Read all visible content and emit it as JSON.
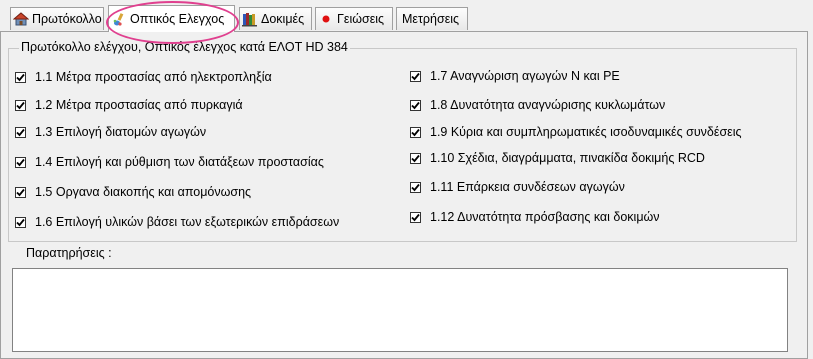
{
  "tabs": [
    {
      "label": "Πρωτόκολλο",
      "icon": "house-icon",
      "active": false
    },
    {
      "label": "Οπτικός Ελεγχος",
      "icon": "paint-brush-icon",
      "active": true
    },
    {
      "label": "Δοκιμές",
      "icon": "books-icon",
      "active": false
    },
    {
      "label": "Γειώσεις",
      "icon": "red-dot-icon",
      "active": false
    },
    {
      "label": "Μετρήσεις",
      "icon": "",
      "active": false
    }
  ],
  "group": {
    "title": "Πρωτόκολλο ελέγχου, Οπτικός έλεγχος κατά ΕΛΟΤ HD 384",
    "left_items": [
      {
        "label": "1.1 Μέτρα προστασίας από ηλεκτροπληξία",
        "checked": true
      },
      {
        "label": "1.2 Μέτρα προστασίας από πυρκαγιά",
        "checked": true
      },
      {
        "label": "1.3 Επιλογή διατομών αγωγών",
        "checked": true
      },
      {
        "label": "1.4 Επιλογή και ρύθμιση των διατάξεων προστασίας",
        "checked": true
      },
      {
        "label": "1.5 Οργανα διακοπής και απομόνωσης",
        "checked": true
      },
      {
        "label": "1.6 Επιλογή υλικών βάσει των εξωτερικών επιδράσεων",
        "checked": true
      }
    ],
    "right_items": [
      {
        "label": "1.7 Αναγνώριση αγωγών Ν και PE",
        "checked": true
      },
      {
        "label": "1.8 Δυνατότητα αναγνώρισης κυκλωμάτων",
        "checked": true
      },
      {
        "label": "1.9 Κύρια και συμπληρωματικές ισοδυναμικές συνδέσεις",
        "checked": true
      },
      {
        "label": "1.10 Σχέδια, διαγράμματα, πινακίδα δοκιμής RCD",
        "checked": true
      },
      {
        "label": "1.11 Επάρκεια συνδέσεων αγωγών",
        "checked": true
      },
      {
        "label": "1.12 Δυνατότητα πρόσβασης και δοκιμών",
        "checked": true
      }
    ]
  },
  "remarks": {
    "label": "Παρατηρήσεις :",
    "value": ""
  },
  "colors": {
    "highlight": "#e0408f",
    "tab_active_bg": "#ffffff",
    "panel_bg": "#f0f0f0"
  }
}
